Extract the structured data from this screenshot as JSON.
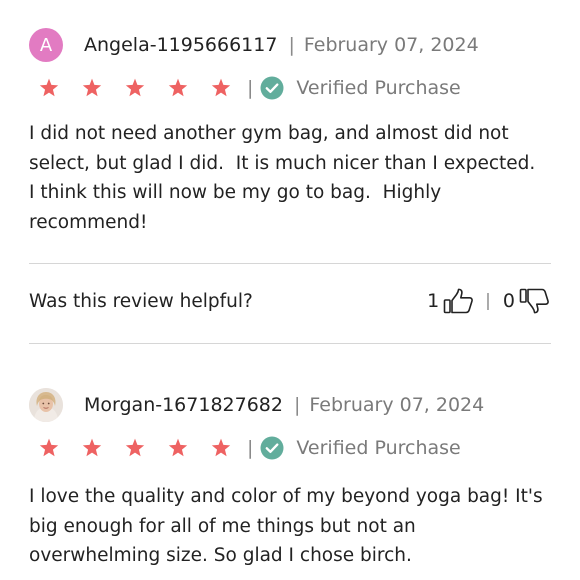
{
  "colors": {
    "star": "#ee6262",
    "verified": "#62ad9c",
    "avatar_a": "#e27bc2",
    "divider": "#d6d6d6"
  },
  "reviews": [
    {
      "avatar_letter": "A",
      "author": "Angela-1195666117",
      "separator": "|",
      "date": "February 07, 2024",
      "rating": 5,
      "rating_max": 5,
      "verified_label": "Verified Purchase",
      "body": "I did not need another gym bag, and almost did not select, but glad I did.  It is much nicer than I expected.  I think this will now be my go to bag.  Highly recommend!",
      "helpful_question": "Was this review helpful?",
      "upvotes": "1",
      "downvotes": "0"
    },
    {
      "avatar_icon": "user-photo-avatar",
      "author": "Morgan-1671827682",
      "separator": "|",
      "date": "February 07, 2024",
      "rating": 5,
      "rating_max": 5,
      "verified_label": "Verified Purchase",
      "body": "I love the quality and color of my beyond yoga bag! It's big enough for all of me things but not an overwhelming size. So glad I chose birch."
    }
  ],
  "icons": {
    "star": "star-icon",
    "verified": "verified-check-icon",
    "thumbs_up": "thumbs-up-icon",
    "thumbs_down": "thumbs-down-icon"
  }
}
